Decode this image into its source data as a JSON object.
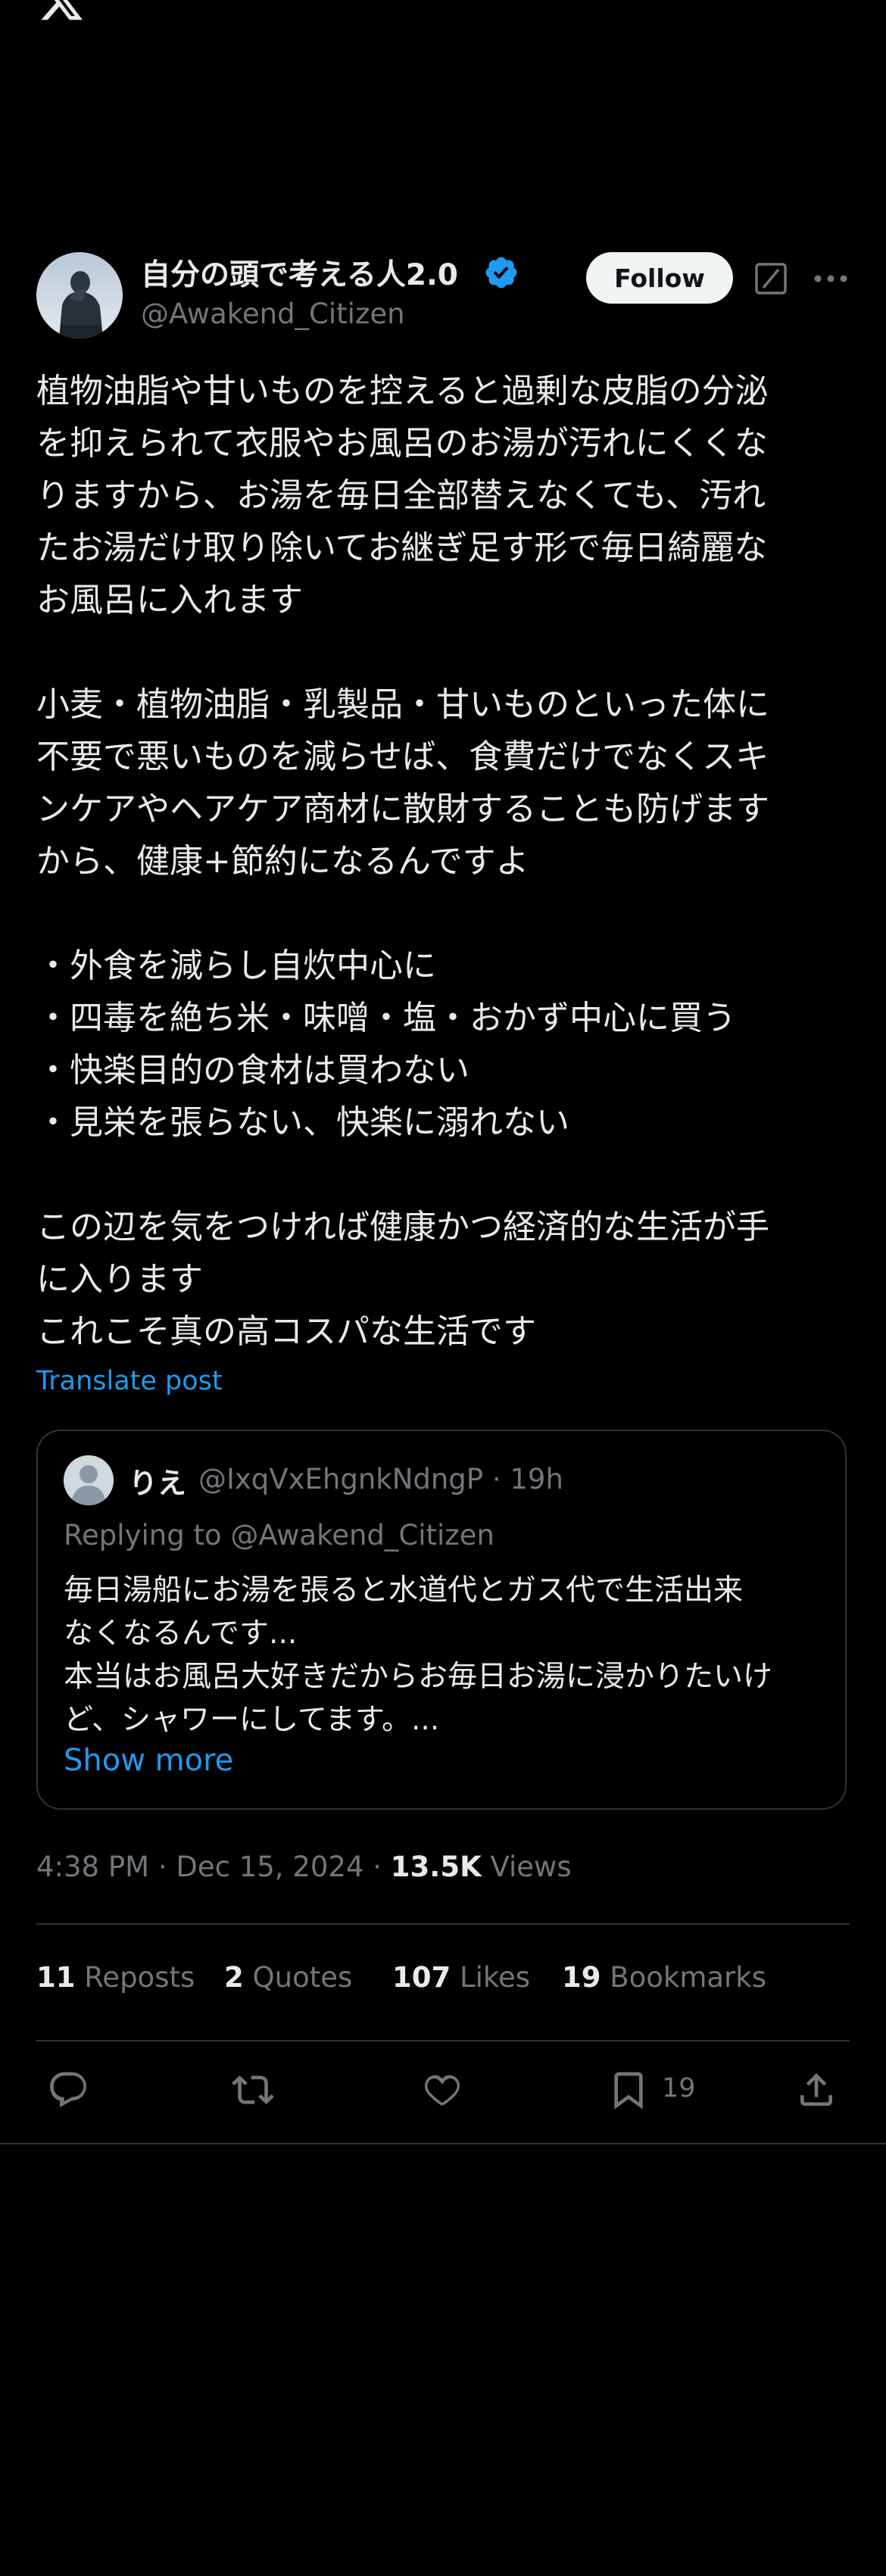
{
  "colors": {
    "background": "#000000",
    "text": "#e7e9ea",
    "muted": "#71767b",
    "accent": "#1d9bf0",
    "border": "#2f3336"
  },
  "header": {
    "logo_icon": "x-logo-icon",
    "menu_icon": "more-horizontal-icon"
  },
  "author": {
    "name": "自分の頭で考える人2.0",
    "handle": "@Awakend_Citizen",
    "verified_icon": "verified-badge-icon",
    "follow_label": "Follow"
  },
  "tweet": {
    "paragraphs": [
      [
        "植物油脂や甘いものを控えると過剰な皮脂の分泌",
        "を抑えられて衣服やお風呂のお湯が汚れにくくな",
        "りますから、お湯を毎日全部替えなくても、汚れ",
        "たお湯だけ取り除いてお継ぎ足す形で毎日綺麗な",
        "お風呂に入れます"
      ],
      [
        "小麦・植物油脂・乳製品・甘いものといった体に",
        "不要で悪いものを減らせば、食費だけでなくスキ",
        "ンケアやヘアケア商材に散財することも防げます",
        "から、健康+節約になるんですよ"
      ],
      [
        "・外食を減らし自炊中心に",
        "・四毒を絶ち米・味噌・塩・おかず中心に買う",
        "・快楽目的の食材は買わない",
        "・見栄を張らない、快楽に溺れない"
      ],
      [
        "この辺を気をつければ健康かつ経済的な生活が手",
        "に入ります",
        "これこそ真の高コスパな生活です"
      ]
    ],
    "translate_label": "Translate post"
  },
  "quoted": {
    "name": "りえ",
    "handle_time": "@IxqVxEhgnkNdngP · 19h",
    "replying_to": "Replying to @Awakend_Citizen",
    "lines": [
      "毎日湯船にお湯を張ると水道代とガス代で生活出来",
      "なくなるんです...",
      "本当はお風呂大好きだからお毎日お湯に浸かりたいけ",
      "ど、シャワーにしてます。..."
    ],
    "show_more_label": "Show more"
  },
  "meta": {
    "time_date": "4:38 PM · Dec 15, 2024 · ",
    "views_count": "13.5K",
    "views_label": " Views"
  },
  "stats": {
    "reposts_count": "11",
    "reposts_label": " Reposts",
    "quotes_count": "2",
    "quotes_label": " Quotes",
    "likes_count": "107",
    "likes_label": " Likes",
    "bookmarks_count": "19",
    "bookmarks_label": " Bookmarks"
  },
  "actions": {
    "bookmark_count": "19"
  }
}
